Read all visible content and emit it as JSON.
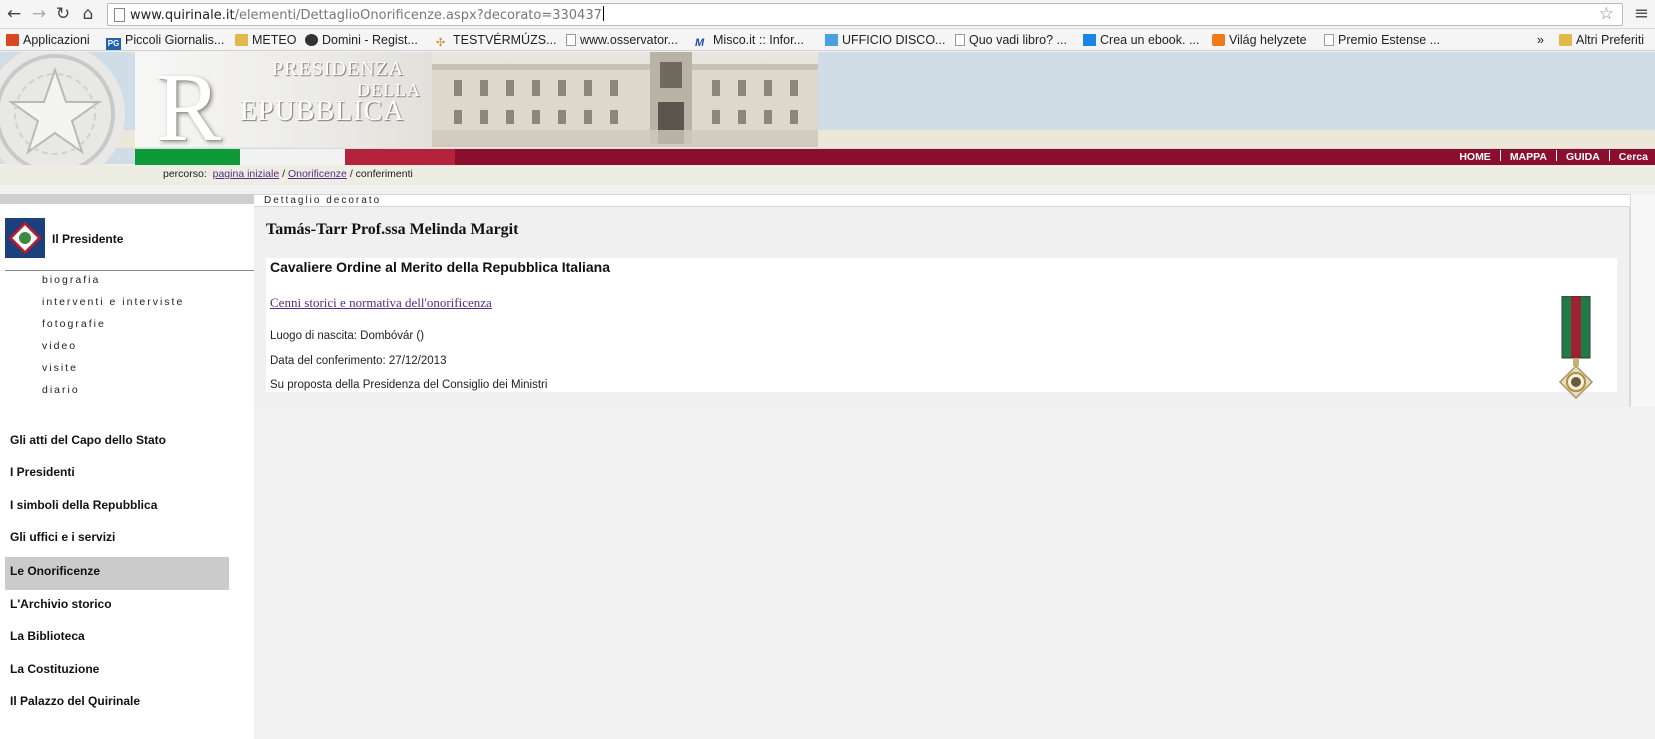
{
  "browser": {
    "url_host": "www.quirinale.it",
    "url_path": "/elementi/DettaglioOnorificenze.aspx?decorato=330437"
  },
  "bookmarks": {
    "items": [
      {
        "label": "Applicazioni",
        "icon": "apps-grid-icon"
      },
      {
        "label": "Piccoli Giornalis...",
        "icon": "pg-icon"
      },
      {
        "label": "METEO",
        "icon": "folder-icon"
      },
      {
        "label": "Domini - Regist...",
        "icon": "globe-icon"
      },
      {
        "label": "TESTVÉRMÚZS...",
        "icon": "site-icon"
      },
      {
        "label": "www.osservator...",
        "icon": "page-icon"
      },
      {
        "label": "Misco.it :: Infor...",
        "icon": "misco-icon"
      },
      {
        "label": "UFFICIO DISCO...",
        "icon": "bird-icon"
      },
      {
        "label": "Quo vadi libro? ...",
        "icon": "page-icon"
      },
      {
        "label": "Crea un ebook. ...",
        "icon": "flag-icon"
      },
      {
        "label": "Világ helyzete",
        "icon": "blogger-icon"
      },
      {
        "label": "Premio Estense ...",
        "icon": "page-icon"
      }
    ],
    "overflow": "»",
    "other_folder": "Altri Preferiti"
  },
  "header": {
    "logo_R": "R",
    "logo_line1": "PRESIDENZA",
    "logo_line2": "DELLA",
    "logo_line3": "EPUBBLICA",
    "emblem_text": "REPUBBLICA ITALIANA",
    "topnav": [
      "HOME",
      "MAPPA",
      "GUIDA",
      "Cerca"
    ],
    "colors": {
      "green": "#0f9a3a",
      "white": "#f2f2f2",
      "red": "#b4233c",
      "bar": "#8b0e2c"
    }
  },
  "breadcrumb": {
    "prefix": "percorso:",
    "link1": "pagina iniziale",
    "link2": "Onorificenze",
    "current": "conferimenti"
  },
  "sidebar": {
    "president_label": "Il Presidente",
    "sub_items": [
      "biografia",
      "interventi e interviste",
      "fotografie",
      "video",
      "visite",
      "diario"
    ],
    "main_items": [
      "Gli atti del Capo dello Stato",
      "I Presidenti",
      "I simboli della Repubblica",
      "Gli uffici e i servizi",
      "Le Onorificenze",
      "L'Archivio storico",
      "La Biblioteca",
      "La Costituzione",
      "Il Palazzo del Quirinale"
    ]
  },
  "content": {
    "tab_label": "Dettaglio decorato",
    "name": "Tamás-Tarr Prof.ssa Melinda Margit",
    "honor_title": "Cavaliere Ordine al Merito della Repubblica Italiana",
    "honor_link": "Cenni storici e normativa dell'onorificenza",
    "birthplace_label": "Luogo di nascita:",
    "birthplace_value": "Dombóvár ()",
    "date_label": "Data del conferimento:",
    "date_value": "27/12/2013",
    "proposal": "Su proposta della Presidenza del Consiglio dei Ministri"
  }
}
